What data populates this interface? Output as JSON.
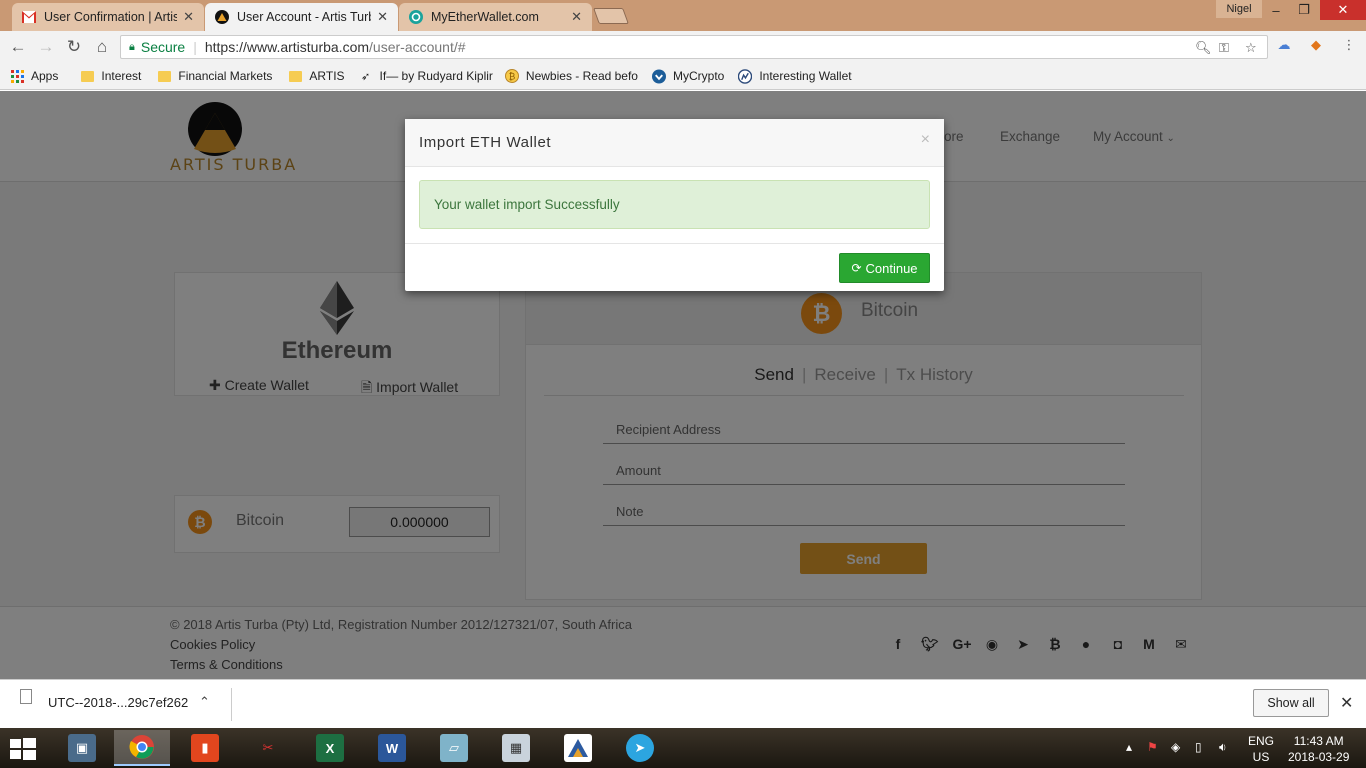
{
  "browser": {
    "tabs": [
      {
        "title": "User Confirmation | Artis",
        "favicon": "gmail-icon",
        "active": false
      },
      {
        "title": "User Account - Artis Turb",
        "favicon": "artis-turba-icon",
        "active": true
      },
      {
        "title": "MyEtherWallet.com",
        "favicon": "myetherwallet-icon",
        "active": false
      }
    ],
    "tab_close": "✕",
    "profile_name": "Nigel",
    "secure_label": "Secure",
    "url_host": "https://www.artisturba.com",
    "url_path": "/user-account/#",
    "bookmarks": [
      {
        "label": "Apps",
        "icon": "apps-grid-icon"
      },
      {
        "label": "Interest",
        "icon": "folder-icon"
      },
      {
        "label": "Financial Markets",
        "icon": "folder-icon"
      },
      {
        "label": "ARTIS",
        "icon": "folder-icon"
      },
      {
        "label": "If— by Rudyard Kiplir",
        "icon": "bird-icon"
      },
      {
        "label": "Newbies - Read befo",
        "icon": "bitcoin-coin-icon"
      },
      {
        "label": "MyCrypto",
        "icon": "mycrypto-icon"
      },
      {
        "label": "Interesting Wallet",
        "icon": "wallet-logo-icon"
      }
    ]
  },
  "site": {
    "logo_text": "ARTIS TURBA",
    "nav": {
      "partial": "ore",
      "exchange": "Exchange",
      "my_account": "My Account"
    },
    "ethereum": {
      "title": "Ethereum",
      "create": "Create Wallet",
      "import": "Import Wallet"
    },
    "bitcoin_row": {
      "label": "Bitcoin",
      "balance": "0.000000"
    },
    "wallet_panel": {
      "coin": "Bitcoin",
      "tabs": [
        "Send",
        "Receive",
        "Tx History"
      ],
      "fields": [
        "Recipient Address",
        "Amount",
        "Note"
      ],
      "send_label": "Send"
    },
    "footer": {
      "copyright": "© 2018 Artis Turba (Pty) Ltd, Registration Number 2012/127321/07, South Africa",
      "cookies": "Cookies Policy",
      "terms": "Terms & Conditions",
      "social_icons": [
        "facebook-icon",
        "twitter-icon",
        "google-plus-icon",
        "github-icon",
        "telegram-icon",
        "bitcoin-icon",
        "reddit-icon",
        "instagram-icon",
        "medium-icon",
        "email-icon"
      ]
    }
  },
  "modal": {
    "title": "Import ETH Wallet",
    "close": "×",
    "message": "Your wallet import Successfully",
    "continue_label": "Continue"
  },
  "download_bar": {
    "filename": "UTC--2018-...29c7ef262",
    "show_all": "Show all"
  },
  "taskbar": {
    "language": "ENG",
    "region": "US",
    "time": "11:43 AM",
    "date": "2018-03-29"
  },
  "colors": {
    "accent_gold": "#e6a12c",
    "success_green": "#2aa732",
    "bitcoin_orange": "#f7931a",
    "chrome_tabstrip": "#c99974"
  }
}
